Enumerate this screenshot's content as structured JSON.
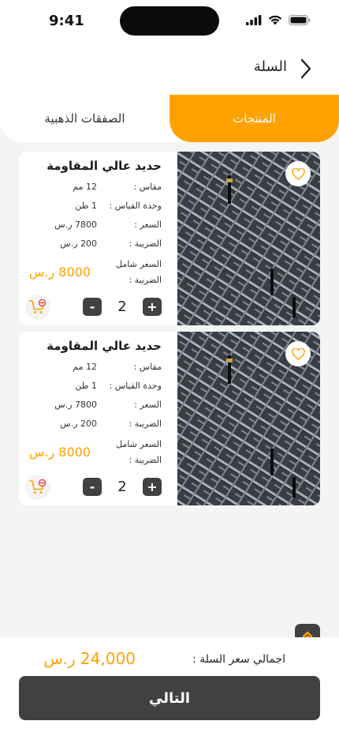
{
  "status_bar": {
    "time": "9:41"
  },
  "header": {
    "title": "السلة",
    "back_icon": "chevron-right-icon"
  },
  "tabs": [
    {
      "label": "المنتجات",
      "active": true
    },
    {
      "label": "الصفقات الذهبية",
      "active": false
    }
  ],
  "colors": {
    "accent": "#ffa200",
    "dark": "#414141",
    "background": "#f4f4f4"
  },
  "products": [
    {
      "name": "حديد عالي المقاومة",
      "specs": [
        {
          "label": "مقاس :",
          "value": "12 مم"
        },
        {
          "label": "وحدة القياس :",
          "value": "1 طن"
        },
        {
          "label": "السعر :",
          "value": "7800 ر.س"
        },
        {
          "label": "الضريبة :",
          "value": "200 ر.س"
        }
      ],
      "total_label": "السعر شامل الضريبة :",
      "total_price": "8000 ر.س",
      "quantity": "2",
      "plus_label": "+",
      "minus_label": "-"
    },
    {
      "name": "حديد عالي المقاومة",
      "specs": [
        {
          "label": "مقاس :",
          "value": "12 مم"
        },
        {
          "label": "وحدة القياس :",
          "value": "1 طن"
        },
        {
          "label": "السعر :",
          "value": "7800 ر.س"
        },
        {
          "label": "الضريبة :",
          "value": "200 ر.س"
        }
      ],
      "total_label": "السعر شامل الضريبة :",
      "total_price": "8000 ر.س",
      "quantity": "2",
      "plus_label": "+",
      "minus_label": "-"
    }
  ],
  "footer": {
    "total_label": "اجمالي سعر السلة :",
    "total_value": "24,000 ر.س",
    "next_label": "التالي"
  }
}
